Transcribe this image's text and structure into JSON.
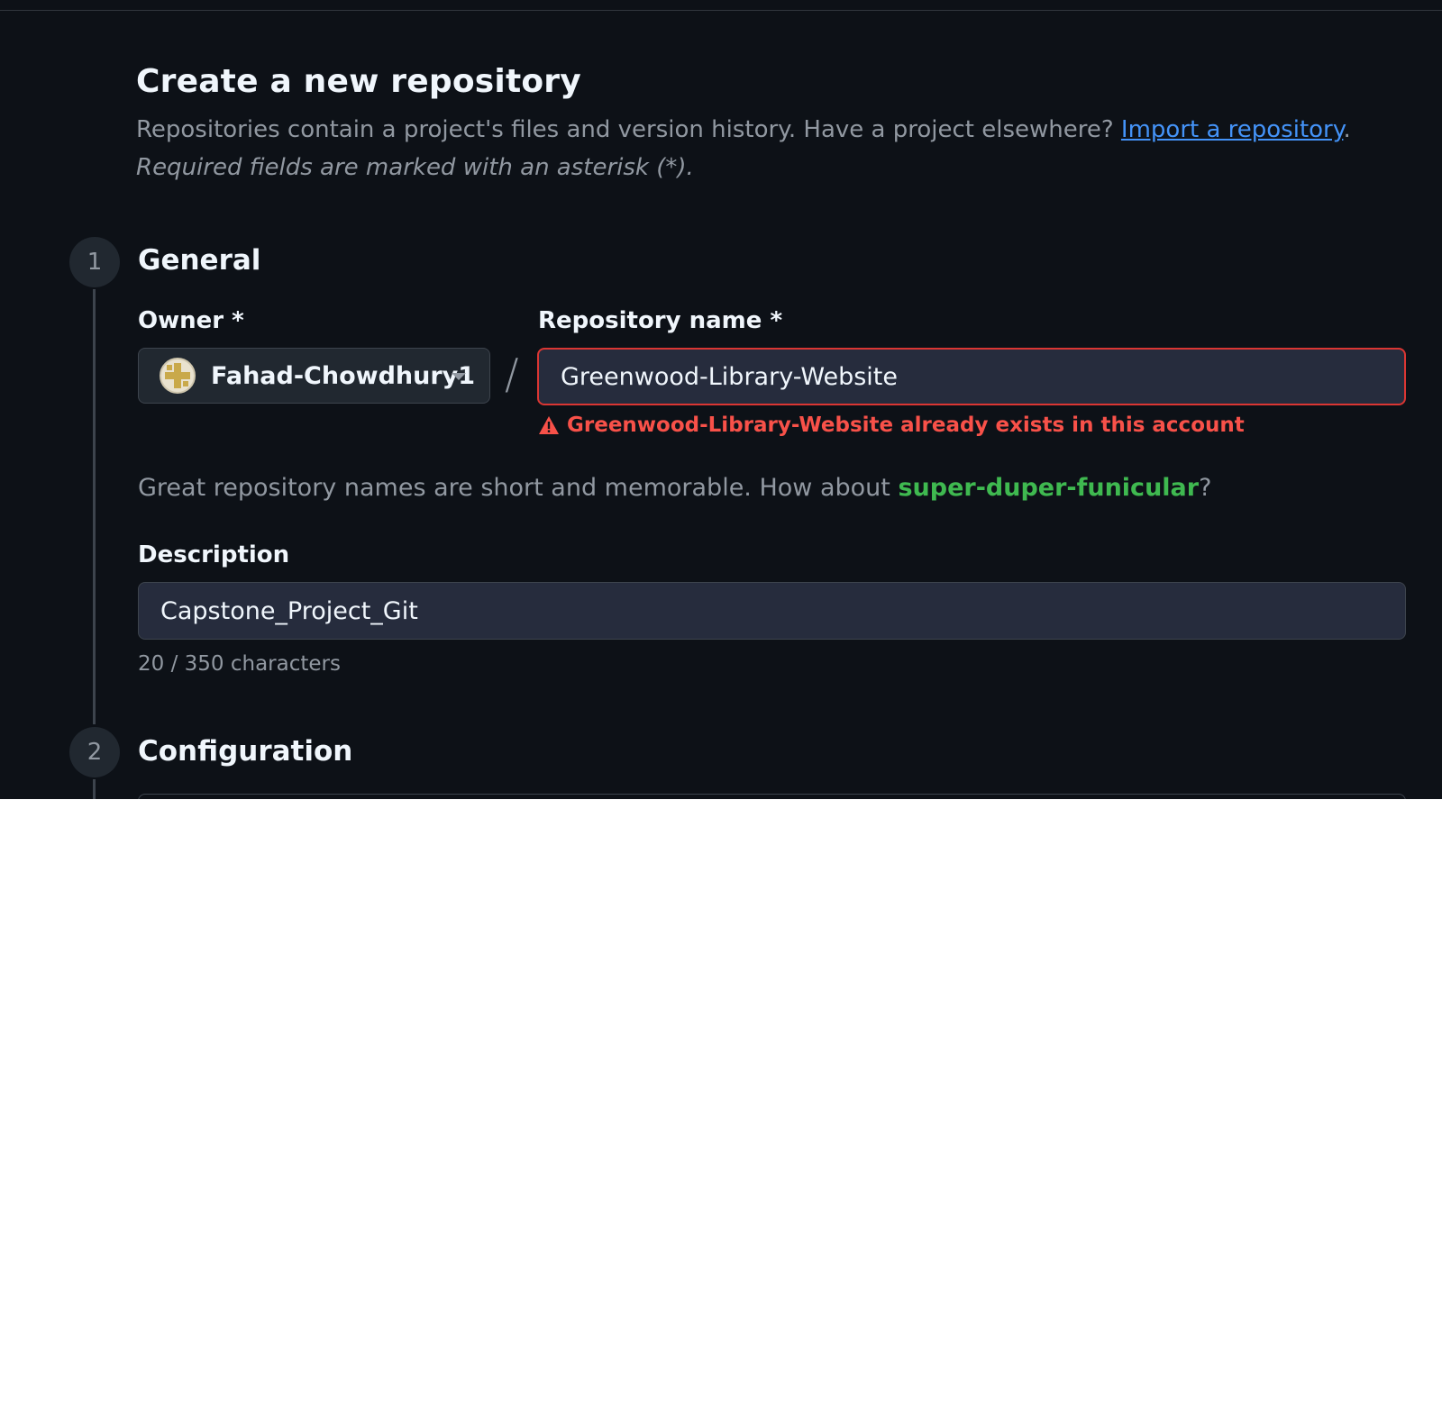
{
  "page": {
    "title": "Create a new repository",
    "intro_text": "Repositories contain a project's files and version history. Have a project elsewhere? ",
    "import_link": "Import a repository",
    "intro_end": ".",
    "required_note": "Required fields are marked with an asterisk (*)."
  },
  "steps": [
    {
      "number": "1",
      "title": "General"
    },
    {
      "number": "2",
      "title": "Configuration"
    }
  ],
  "general": {
    "owner_label": "Owner *",
    "owner_value": "Fahad-Chowdhury1",
    "separator": "/",
    "repo_name_label": "Repository name *",
    "repo_name_value": "Greenwood-Library-Website",
    "error_message": "Greenwood-Library-Website already exists in this account",
    "suggestion_prefix": "Great repository names are short and memorable. How about ",
    "suggestion_name": "super-duper-funicular",
    "suggestion_suffix": "?",
    "description_label": "Description",
    "description_value": "Capstone_Project_Git",
    "char_count": "20 / 350 characters"
  },
  "colors": {
    "background": "#0d1117",
    "error": "#f85149",
    "link": "#4493f8",
    "suggestion": "#3fb950"
  }
}
